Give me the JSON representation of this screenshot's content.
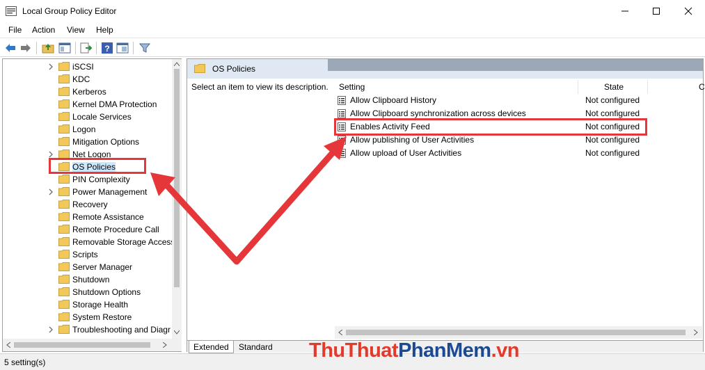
{
  "window": {
    "title": "Local Group Policy Editor"
  },
  "menu": [
    "File",
    "Action",
    "View",
    "Help"
  ],
  "tree": {
    "items": [
      {
        "label": "iSCSI",
        "expandable": true
      },
      {
        "label": "KDC",
        "expandable": false
      },
      {
        "label": "Kerberos",
        "expandable": false
      },
      {
        "label": "Kernel DMA Protection",
        "expandable": false
      },
      {
        "label": "Locale Services",
        "expandable": false
      },
      {
        "label": "Logon",
        "expandable": false
      },
      {
        "label": "Mitigation Options",
        "expandable": false
      },
      {
        "label": "Net Logon",
        "expandable": true
      },
      {
        "label": "OS Policies",
        "expandable": false,
        "selected": true
      },
      {
        "label": "PIN Complexity",
        "expandable": false
      },
      {
        "label": "Power Management",
        "expandable": true
      },
      {
        "label": "Recovery",
        "expandable": false
      },
      {
        "label": "Remote Assistance",
        "expandable": false
      },
      {
        "label": "Remote Procedure Call",
        "expandable": false
      },
      {
        "label": "Removable Storage Access",
        "expandable": false
      },
      {
        "label": "Scripts",
        "expandable": false
      },
      {
        "label": "Server Manager",
        "expandable": false
      },
      {
        "label": "Shutdown",
        "expandable": false
      },
      {
        "label": "Shutdown Options",
        "expandable": false
      },
      {
        "label": "Storage Health",
        "expandable": false
      },
      {
        "label": "System Restore",
        "expandable": false
      },
      {
        "label": "Troubleshooting and Diagr",
        "expandable": true
      }
    ]
  },
  "details": {
    "header": "OS Policies",
    "description": "Select an item to view its description.",
    "columns": {
      "setting": "Setting",
      "state": "State",
      "comment": "C"
    },
    "settings": [
      {
        "name": "Allow Clipboard History",
        "state": "Not configured"
      },
      {
        "name": "Allow Clipboard synchronization across devices",
        "state": "Not configured"
      },
      {
        "name": "Enables Activity Feed",
        "state": "Not configured"
      },
      {
        "name": "Allow publishing of User Activities",
        "state": "Not configured"
      },
      {
        "name": "Allow upload of User Activities",
        "state": "Not configured"
      }
    ],
    "tabs": [
      "Extended",
      "Standard"
    ]
  },
  "status": "5 setting(s)",
  "watermark": {
    "part1": "ThuThuat",
    "part2": "PhanMem",
    "part3": ".vn"
  },
  "colors": {
    "annotation": "#e5373a",
    "folder": "#f2c85a",
    "watermark_red": "#e23a2b",
    "watermark_blue": "#1b4a93"
  }
}
